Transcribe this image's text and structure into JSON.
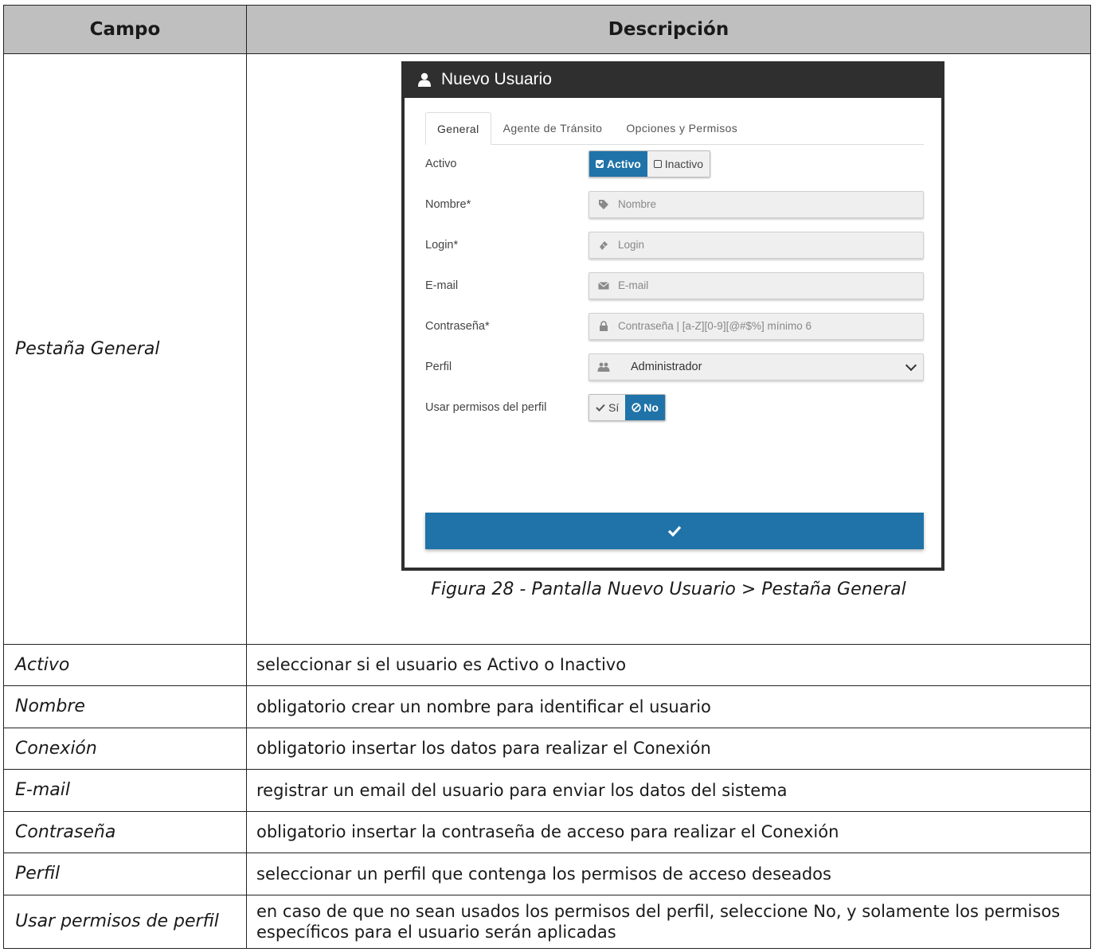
{
  "table": {
    "header_field": "Campo",
    "header_desc": "Descripción",
    "main_field": "Pestaña General",
    "caption": "Figura 28 - Pantalla Nuevo Usuario > Pestaña General",
    "rows": [
      {
        "field": "Activo",
        "desc": "seleccionar si el usuario es Activo o Inactivo"
      },
      {
        "field": "Nombre",
        "desc": "obligatorio crear un nombre para identificar el usuario"
      },
      {
        "field": "Conexión",
        "desc": "obligatorio insertar los datos para realizar el Conexión"
      },
      {
        "field": "E-mail",
        "desc": "registrar un email del usuario para enviar los datos del sistema"
      },
      {
        "field": "Contraseña",
        "desc": "obligatorio insertar la contraseña de acceso para realizar el Conexión"
      },
      {
        "field": "Perfil",
        "desc": "seleccionar un perfil que contenga los permisos de acceso deseados"
      },
      {
        "field": "Usar permisos de perfil",
        "desc": "en caso de que no sean usados los permisos del perfil, seleccione No, y solamente los permisos específicos para el usuario serán aplicadas"
      }
    ]
  },
  "screenshot": {
    "title": "Nuevo Usuario",
    "tabs": [
      "General",
      "Agente de Tránsito",
      "Opciones y Permisos"
    ],
    "active_tab": "General",
    "form": {
      "activo_label": "Activo",
      "activo_on": "Activo",
      "activo_off": "Inactivo",
      "nombre_label": "Nombre*",
      "nombre_placeholder": "Nombre",
      "login_label": "Login*",
      "login_placeholder": "Login",
      "email_label": "E-mail",
      "email_placeholder": "E-mail",
      "password_label": "Contraseña*",
      "password_placeholder": "Contraseña | [a-Z][0-9][@#$%] mínimo 6",
      "perfil_label": "Perfil",
      "perfil_value": "Administrador",
      "permisos_label": "Usar permisos del perfil",
      "permisos_si": "Sí",
      "permisos_no": "No"
    },
    "icons": {
      "user": "user-icon",
      "tag": "tag-icon",
      "ticket": "ticket-icon",
      "envelope": "envelope-icon",
      "lock": "lock-icon",
      "users": "users-icon",
      "check": "check-icon",
      "ban": "ban-icon"
    },
    "colors": {
      "header_bg": "#2f2f2f",
      "accent": "#1f73a8"
    }
  }
}
